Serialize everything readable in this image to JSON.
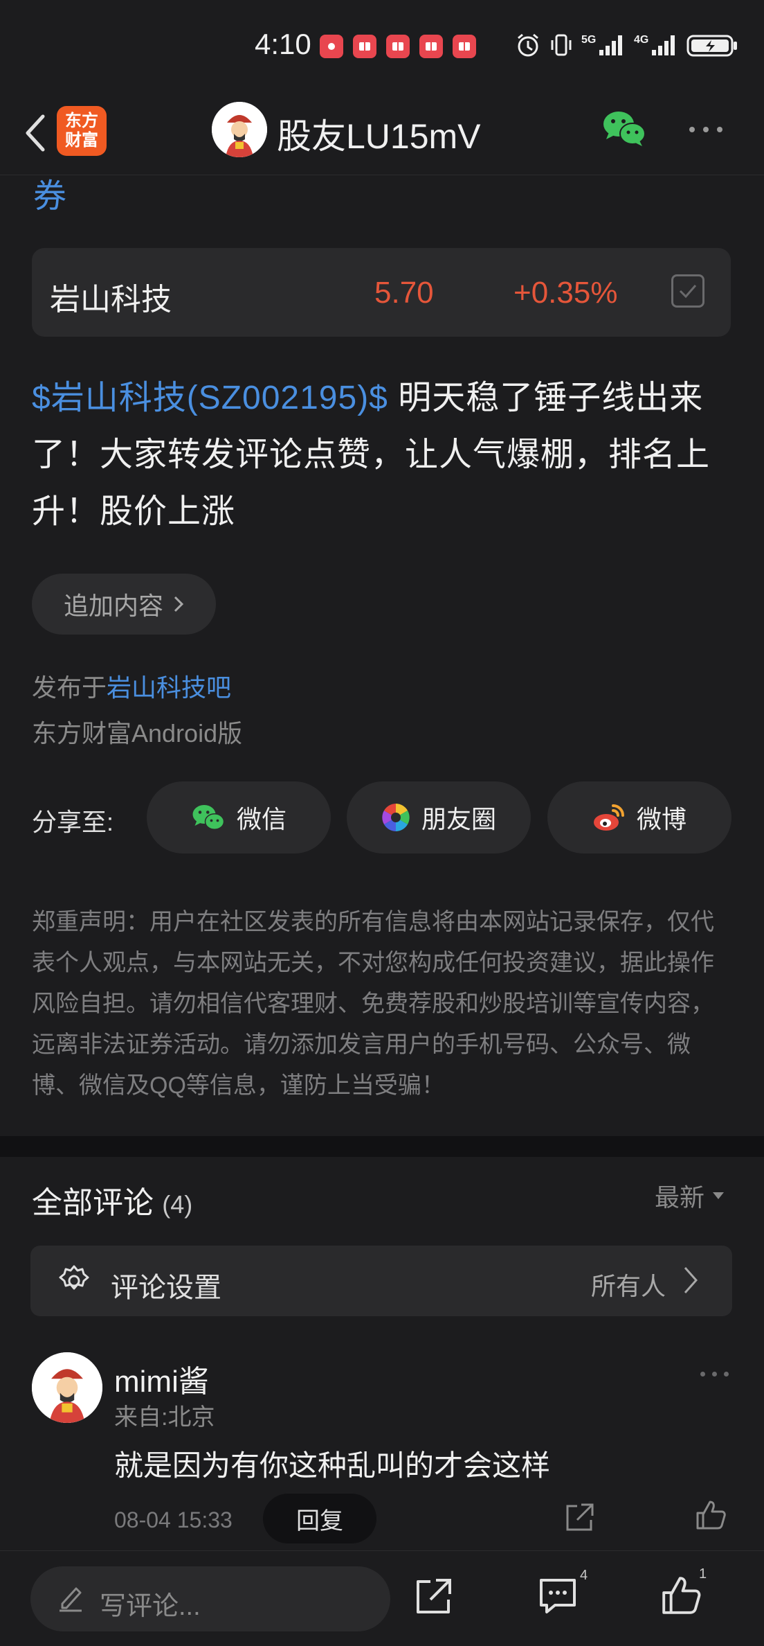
{
  "status_bar": {
    "time": "4:10",
    "notification_icons": [
      "huawei-app-icon",
      "book-app-icon",
      "book-app-icon",
      "book-app-icon",
      "book-app-icon"
    ],
    "signal_1": "5G",
    "signal_2": "4G"
  },
  "header": {
    "logo_line1": "东方",
    "logo_line2": "财富",
    "title": "股友LU15mV"
  },
  "cut_text": "券",
  "stock_card": {
    "name": "岩山科技",
    "price": "5.70",
    "change": "+0.35%"
  },
  "post": {
    "stock_link": "$岩山科技(SZ002195)$",
    "text": " 明天稳了锤子线出来了！大家转发评论点赞，让人气爆棚，排名上升！股价上涨"
  },
  "add_content_label": "追加内容",
  "meta": {
    "published_prefix": "发布于",
    "bar_name": "岩山科技吧",
    "client": "东方财富Android版"
  },
  "share": {
    "label": "分享至:",
    "wechat": "微信",
    "moments": "朋友圈",
    "weibo": "微博"
  },
  "disclaimer": "郑重声明：用户在社区发表的所有信息将由本网站记录保存，仅代表个人观点，与本网站无关，不对您构成任何投资建议，据此操作风险自担。请勿相信代客理财、免费荐股和炒股培训等宣传内容，远离非法证券活动。请勿添加发言用户的手机号码、公众号、微博、微信及QQ等信息，谨防上当受骗！",
  "comments": {
    "title": "全部评论",
    "count": "(4)",
    "sort": "最新",
    "settings_label": "评论设置",
    "settings_value": "所有人",
    "items": [
      {
        "user": "mimi酱",
        "location": "来自:北京",
        "text": "就是因为有你这种乱叫的才会这样",
        "time": "08-04 15:33",
        "reply_label": "回复"
      }
    ]
  },
  "bottom_bar": {
    "input_placeholder": "写评论...",
    "comment_count": "4",
    "like_count": "1"
  },
  "colors": {
    "accent_blue": "#4a8fe0",
    "stock_red": "#e5563a",
    "brand_orange": "#f05a22",
    "wechat_green": "#3fc25c"
  }
}
